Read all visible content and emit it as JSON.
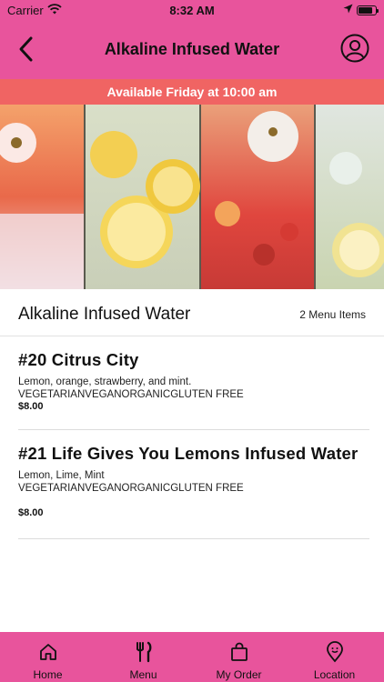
{
  "status_bar": {
    "carrier": "Carrier",
    "time": "8:32 AM",
    "battery_level": 0.85
  },
  "header": {
    "title": "Alkaline Infused Water"
  },
  "banner": {
    "text": "Available Friday at 10:00 am",
    "color": "#f06463"
  },
  "theme": {
    "brand": "#e8549c"
  },
  "section": {
    "title": "Alkaline Infused Water",
    "count": "2 Menu Items"
  },
  "items": [
    {
      "name": "#20 Citrus City",
      "description": "Lemon, orange, strawberry, and mint.",
      "tags": "VEGETARIANVEGANORGANICGLUTEN FREE",
      "price": "$8.00"
    },
    {
      "name": "#21 Life Gives You Lemons Infused Water",
      "description": "Lemon, Lime, Mint",
      "tags": "VEGETARIANVEGANORGANICGLUTEN FREE",
      "price": "$8.00"
    }
  ],
  "tabs": [
    {
      "label": "Home",
      "icon": "home-icon"
    },
    {
      "label": "Menu",
      "icon": "utensils-icon"
    },
    {
      "label": "My Order",
      "icon": "shopping-bag-icon"
    },
    {
      "label": "Location",
      "icon": "location-pin-icon"
    }
  ]
}
